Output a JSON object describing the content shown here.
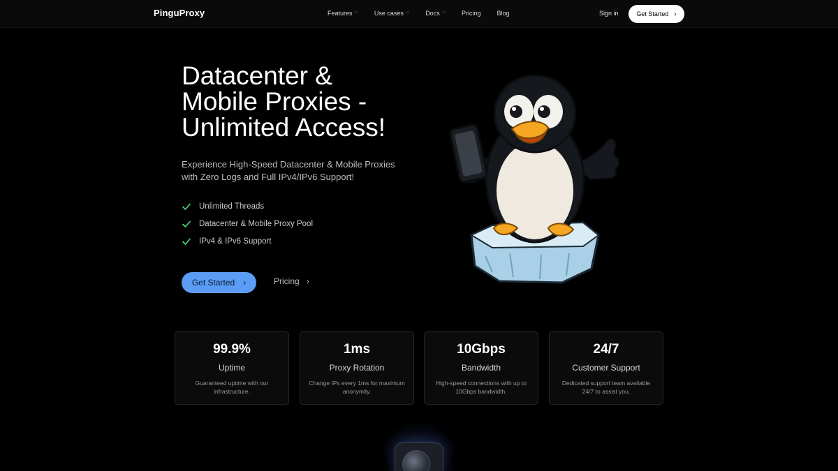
{
  "nav": {
    "logo": "PinguProxy",
    "links": [
      {
        "label": "Features",
        "dropdown": true
      },
      {
        "label": "Use cases",
        "dropdown": true
      },
      {
        "label": "Docs",
        "dropdown": true
      },
      {
        "label": "Pricing",
        "dropdown": false
      },
      {
        "label": "Blog",
        "dropdown": false
      }
    ],
    "signin": "Sign in",
    "cta": "Get Started"
  },
  "hero": {
    "title_lines": [
      "Datacenter &",
      "Mobile Proxies -",
      "Unlimited Access!"
    ],
    "subtitle_lines": [
      "Experience High-Speed Datacenter & Mobile Proxies",
      "with Zero Logs and Full IPv4/IPv6 Support!"
    ],
    "features": [
      "Unlimited Threads",
      "Datacenter & Mobile Proxy Pool",
      "IPv4 & IPv6 Support"
    ],
    "primary_cta": "Get Started",
    "secondary_cta": "Pricing"
  },
  "stats": [
    {
      "value": "99.9%",
      "label": "Uptime",
      "desc": "Guaranteed uptime with our infrastructure."
    },
    {
      "value": "1ms",
      "label": "Proxy Rotation",
      "desc": "Change IPs every 1ms for maximum anonymity."
    },
    {
      "value": "10Gbps",
      "label": "Bandwidth",
      "desc": "High-speed connections with up to 10Gbps bandwidth."
    },
    {
      "value": "24/7",
      "label": "Customer Support",
      "desc": "Dedicated support team available 24/7 to assist you."
    }
  ],
  "colors": {
    "accent": "#5b9cf5",
    "check": "#4ade80",
    "background": "#000000"
  },
  "icons": {
    "check": "check-icon",
    "chevron": "chevron-right-icon",
    "dropdown": "chevron-down-icon",
    "mascot": "penguin-mascot"
  }
}
